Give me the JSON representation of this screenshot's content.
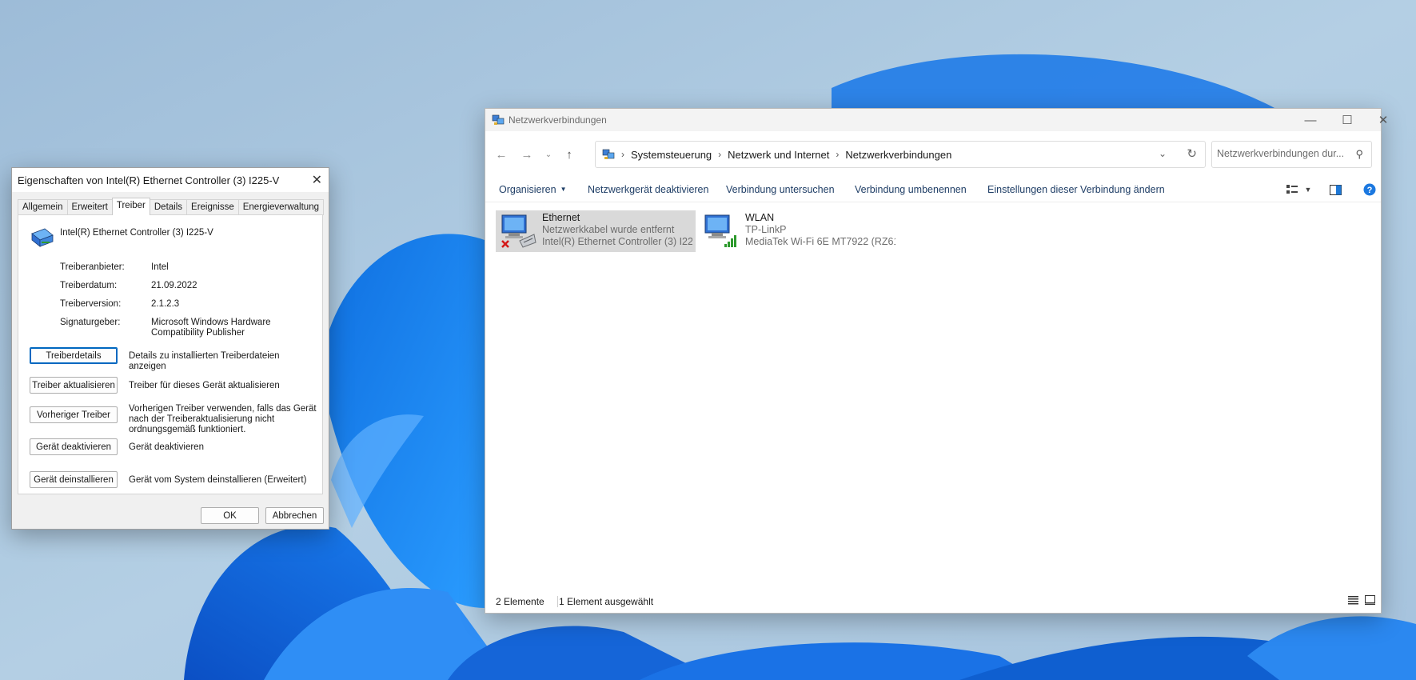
{
  "explorer": {
    "title": "Netzwerkverbindungen",
    "breadcrumb": [
      "Systemsteuerung",
      "Netzwerk und Internet",
      "Netzwerkverbindungen"
    ],
    "search_placeholder": "Netzwerkverbindungen dur...",
    "commands": {
      "organize": "Organisieren",
      "disable": "Netzwerkgerät deaktivieren",
      "diagnose": "Verbindung untersuchen",
      "rename": "Verbindung umbenennen",
      "settings": "Einstellungen dieser Verbindung ändern"
    },
    "connections": [
      {
        "name": "Ethernet",
        "status": "Netzwerkkabel wurde entfernt",
        "adapter": "Intel(R) Ethernet Controller (3) I22..."
      },
      {
        "name": "WLAN",
        "status": "TP-LinkP",
        "adapter": "MediaTek Wi-Fi 6E MT7922 (RZ61..."
      }
    ],
    "status_count": "2 Elemente",
    "status_selected": "1 Element ausgewählt"
  },
  "dialog": {
    "title": "Eigenschaften von Intel(R) Ethernet Controller (3) I225-V",
    "tabs": [
      "Allgemein",
      "Erweitert",
      "Treiber",
      "Details",
      "Ereignisse",
      "Energieverwaltung"
    ],
    "device_name": "Intel(R) Ethernet Controller (3) I225-V",
    "properties": {
      "provider_label": "Treiberanbieter:",
      "provider_value": "Intel",
      "date_label": "Treiberdatum:",
      "date_value": "21.09.2022",
      "version_label": "Treiberversion:",
      "version_value": "2.1.2.3",
      "signer_label": "Signaturgeber:",
      "signer_value": "Microsoft Windows Hardware Compatibility Publisher"
    },
    "actions": {
      "details_btn": "Treiberdetails",
      "details_desc": "Details zu installierten Treiberdateien anzeigen",
      "update_btn": "Treiber aktualisieren",
      "update_desc": "Treiber für dieses Gerät aktualisieren",
      "rollback_btn": "Vorheriger Treiber",
      "rollback_desc": "Vorherigen Treiber verwenden, falls das Gerät nach der Treiberaktualisierung nicht ordnungsgemäß funktioniert.",
      "disable_btn": "Gerät deaktivieren",
      "disable_desc": "Gerät deaktivieren",
      "uninstall_btn": "Gerät deinstallieren",
      "uninstall_desc": "Gerät vom System deinstallieren (Erweitert)"
    },
    "ok": "OK",
    "cancel": "Abbrechen"
  }
}
